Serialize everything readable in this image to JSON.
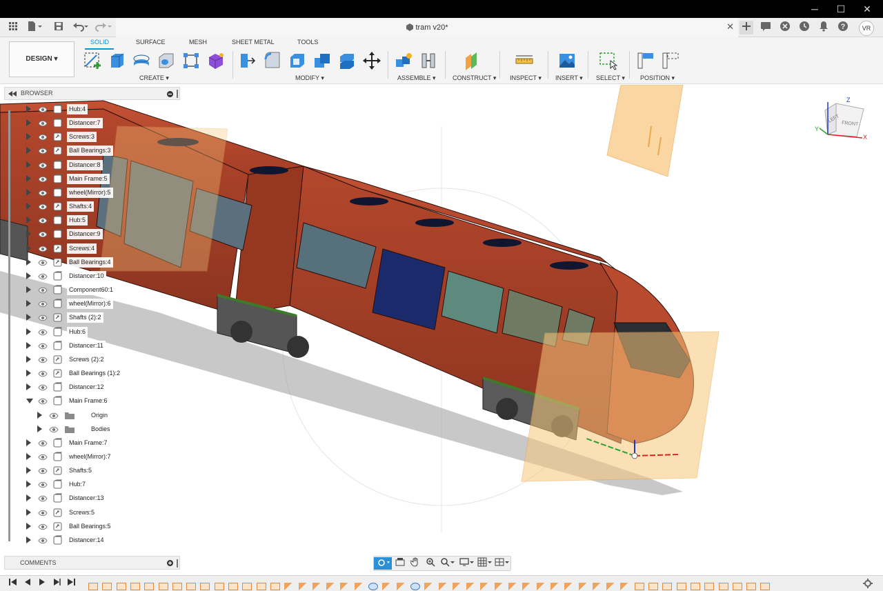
{
  "app": {
    "document_title": "tram v20*",
    "user_initials": "VR"
  },
  "window_controls": {
    "minimize": "─",
    "maximize": "☐",
    "close": "✕"
  },
  "toolbar": {
    "workspace_label": "DESIGN ▾",
    "tabs": [
      {
        "label": "SOLID",
        "active": true
      },
      {
        "label": "SURFACE",
        "active": false
      },
      {
        "label": "MESH",
        "active": false
      },
      {
        "label": "SHEET METAL",
        "active": false
      },
      {
        "label": "TOOLS",
        "active": false
      }
    ],
    "groups": [
      {
        "label": "CREATE ▾"
      },
      {
        "label": "MODIFY ▾"
      },
      {
        "label": "ASSEMBLE ▾"
      },
      {
        "label": "CONSTRUCT ▾"
      },
      {
        "label": "INSPECT ▾"
      },
      {
        "label": "INSERT ▾"
      },
      {
        "label": "SELECT ▾"
      },
      {
        "label": "POSITION ▾"
      }
    ]
  },
  "browser": {
    "title": "BROWSER",
    "items": [
      {
        "label": "Hub:4",
        "expanded": false,
        "icon": "component-icon",
        "indent": 0
      },
      {
        "label": "Distancer:7",
        "expanded": false,
        "icon": "component-icon",
        "indent": 0
      },
      {
        "label": "Screws:3",
        "expanded": false,
        "icon": "linked-component-icon",
        "indent": 0
      },
      {
        "label": "Ball Bearings:3",
        "expanded": false,
        "icon": "linked-component-icon",
        "indent": 0
      },
      {
        "label": "Distancer:8",
        "expanded": false,
        "icon": "component-icon",
        "indent": 0
      },
      {
        "label": "Main Frame:5",
        "expanded": false,
        "icon": "component-icon",
        "indent": 0
      },
      {
        "label": "wheel(Mirror):5",
        "expanded": false,
        "icon": "component-icon",
        "indent": 0
      },
      {
        "label": "Shafts:4",
        "expanded": false,
        "icon": "linked-component-icon",
        "indent": 0
      },
      {
        "label": "Hub:5",
        "expanded": false,
        "icon": "component-icon",
        "indent": 0
      },
      {
        "label": "Distancer:9",
        "expanded": false,
        "icon": "component-icon",
        "indent": 0
      },
      {
        "label": "Screws:4",
        "expanded": false,
        "icon": "linked-component-icon",
        "indent": 0
      },
      {
        "label": "Ball Bearings:4",
        "expanded": false,
        "icon": "linked-component-icon",
        "indent": 0
      },
      {
        "label": "Distancer:10",
        "expanded": false,
        "icon": "component-icon",
        "indent": 0
      },
      {
        "label": "Component60:1",
        "expanded": false,
        "icon": "component-icon",
        "indent": 0
      },
      {
        "label": "wheel(Mirror):6",
        "expanded": false,
        "icon": "component-icon",
        "indent": 0
      },
      {
        "label": "Shafts (2):2",
        "expanded": false,
        "icon": "linked-component-icon",
        "indent": 0
      },
      {
        "label": "Hub:6",
        "expanded": false,
        "icon": "component-icon",
        "indent": 0
      },
      {
        "label": "Distancer:11",
        "expanded": false,
        "icon": "component-icon",
        "indent": 0
      },
      {
        "label": "Screws (2):2",
        "expanded": false,
        "icon": "linked-component-icon",
        "indent": 0
      },
      {
        "label": "Ball Bearings (1):2",
        "expanded": false,
        "icon": "linked-component-icon",
        "indent": 0
      },
      {
        "label": "Distancer:12",
        "expanded": false,
        "icon": "component-icon",
        "indent": 0
      },
      {
        "label": "Main Frame:6",
        "expanded": true,
        "icon": "component-icon",
        "indent": 0
      },
      {
        "label": "Origin",
        "expanded": false,
        "icon": "folder-icon",
        "indent": 1
      },
      {
        "label": "Bodies",
        "expanded": false,
        "icon": "folder-icon",
        "indent": 1
      },
      {
        "label": "Main Frame:7",
        "expanded": false,
        "icon": "component-icon",
        "indent": 0
      },
      {
        "label": "wheel(Mirror):7",
        "expanded": false,
        "icon": "component-icon",
        "indent": 0
      },
      {
        "label": "Shafts:5",
        "expanded": false,
        "icon": "linked-component-icon",
        "indent": 0
      },
      {
        "label": "Hub:7",
        "expanded": false,
        "icon": "component-icon",
        "indent": 0
      },
      {
        "label": "Distancer:13",
        "expanded": false,
        "icon": "component-icon",
        "indent": 0
      },
      {
        "label": "Screws:5",
        "expanded": false,
        "icon": "linked-component-icon",
        "indent": 0
      },
      {
        "label": "Ball Bearings:5",
        "expanded": false,
        "icon": "linked-component-icon",
        "indent": 0
      },
      {
        "label": "Distancer:14",
        "expanded": false,
        "icon": "component-icon",
        "indent": 0
      }
    ]
  },
  "comments": {
    "title": "COMMENTS"
  },
  "viewcube": {
    "left_label": "LEFT",
    "front_label": "FRONT",
    "axis_x": "X",
    "axis_y": "Y",
    "axis_z": "Z"
  },
  "colors": {
    "accent": "#0696d7",
    "tram_body": "#a8412a",
    "plane": "#f9c77c"
  }
}
